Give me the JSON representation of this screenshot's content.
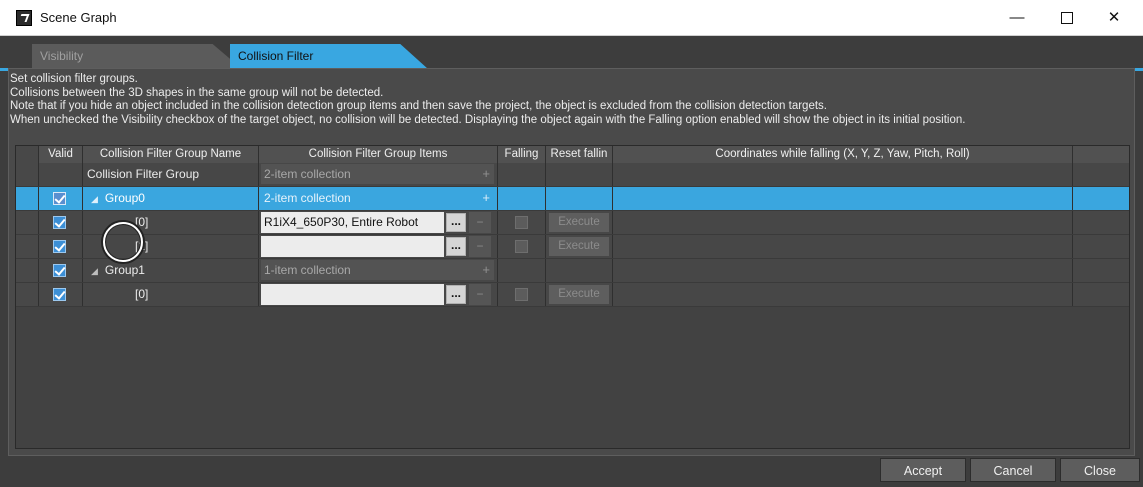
{
  "window": {
    "title": "Scene Graph",
    "minimize": "—",
    "close": "✕"
  },
  "tabs": [
    {
      "label": "Visibility",
      "active": false
    },
    {
      "label": "Collision Filter",
      "active": true
    }
  ],
  "description": [
    "Set collision filter groups.",
    "Collisions between the 3D shapes in the same group will not be detected.",
    "Note that if you hide an object included in the collision detection group items and then save the project, the object is excluded from the collision detection targets.",
    "When unchecked the Visibility checkbox of the target object, no collision will be detected. Displaying the object again with the Falling option enabled will show the object in its initial position."
  ],
  "columns": {
    "valid": "Valid",
    "group_name": "Collision Filter Group Name",
    "group_items": "Collision Filter Group Items",
    "falling": "Falling",
    "reset_falling": "Reset fallin",
    "coordinates": "Coordinates while falling  (X, Y, Z, Yaw, Pitch, Roll)"
  },
  "rows": {
    "root": {
      "name": "Collision Filter Group",
      "items": "2-item collection",
      "add": "+"
    },
    "group0": {
      "name": "Group0",
      "items": "2-item collection",
      "add": "+",
      "expand": "◢"
    },
    "g0_item0": {
      "name": "[0]",
      "value": "R1iX4_650P30, Entire Robot",
      "browse": "...",
      "remove": "−",
      "execute": "Execute"
    },
    "g0_item1": {
      "name": "[1]",
      "value": "",
      "browse": "...",
      "remove": "−",
      "execute": "Execute"
    },
    "group1": {
      "name": "Group1",
      "items": "1-item collection",
      "add": "+",
      "expand": "◢"
    },
    "g1_item0": {
      "name": "[0]",
      "value": "",
      "browse": "...",
      "remove": "−",
      "execute": "Execute"
    }
  },
  "buttons": {
    "accept": "Accept",
    "cancel": "Cancel",
    "close": "Close"
  },
  "colors": {
    "accent": "#39a7e1",
    "background": "#3d3d3d"
  }
}
